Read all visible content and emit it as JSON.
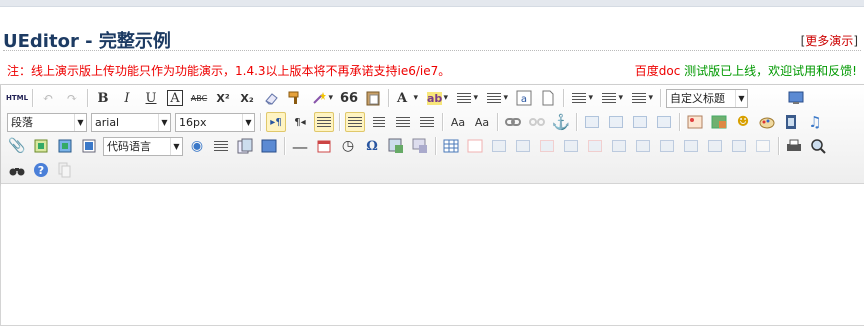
{
  "page": {
    "title": "UEditor - 完整示例",
    "more_link_open": "[",
    "more_link_text": "更多演示",
    "more_link_close": "]",
    "notice": "注：线上演示版上传功能只作为功能演示，1.4.3以上版本将不再承诺支持ie6/ie7。",
    "baidu_doc": "百度doc",
    "baidu_rest": " 测试版已上线，欢迎试用和反馈!"
  },
  "toolbar": {
    "row1": {
      "html_label": "HTML",
      "bold": "B",
      "italic": "I",
      "underline": "U",
      "fontborder": "A",
      "strike": "ABC",
      "superscript": "X²",
      "subscript": "X₂",
      "blockquote": "66",
      "forecolor": "A",
      "custom_heading": "自定义标题"
    },
    "row2": {
      "paragraph": "段落",
      "font_family": "arial",
      "font_size": "16px",
      "ltr": "▸¶",
      "rtl": "¶◂"
    },
    "row3": {
      "code_language": "代码语言",
      "spechars": "Ω"
    }
  },
  "colors": {
    "title": "#1d3b63",
    "notice": "#e00000",
    "link": "#cc0000",
    "green": "#009900",
    "active_bg": "#fff4c2"
  }
}
